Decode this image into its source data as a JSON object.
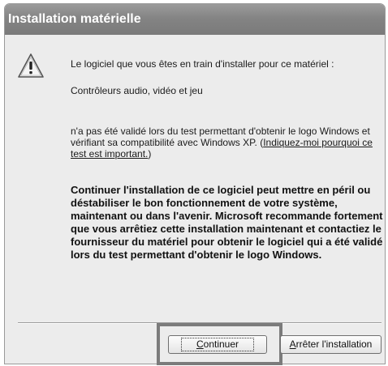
{
  "window": {
    "title": "Installation matérielle"
  },
  "icons": {
    "warning": "warning-icon"
  },
  "message": {
    "intro": "Le logiciel que vous êtes en train d'installer pour ce matériel :",
    "device": "Contrôleurs audio, vidéo et jeu",
    "logo_text_before_link": "n'a pas été validé lors du test permettant d'obtenir le logo Windows et vérifiant sa compatibilité avec Windows XP. (",
    "logo_link": "Indiquez-moi pourquoi ce test est important.",
    "logo_text_after_link": ")",
    "warning": "Continuer l'installation de ce logiciel peut mettre en péril ou déstabiliser le bon fonctionnement de votre système, maintenant ou dans l'avenir. Microsoft recommande fortement que vous arrêtiez cette installation maintenant et contactiez le fournisseur du matériel pour obtenir le logiciel qui a été validé lors du test permettant d'obtenir le logo Windows."
  },
  "buttons": {
    "continue_label": "Continuer",
    "continue_mnemonic": "C",
    "continue_rest": "ontinuer",
    "stop_label": "Arrêter l'installation",
    "stop_mnemonic": "A",
    "stop_rest": "rrêter l'installation"
  },
  "colors": {
    "titlebar": "#8a8a8a",
    "dialog_background": "#ececec",
    "highlight_border": "#7b7b7b"
  }
}
